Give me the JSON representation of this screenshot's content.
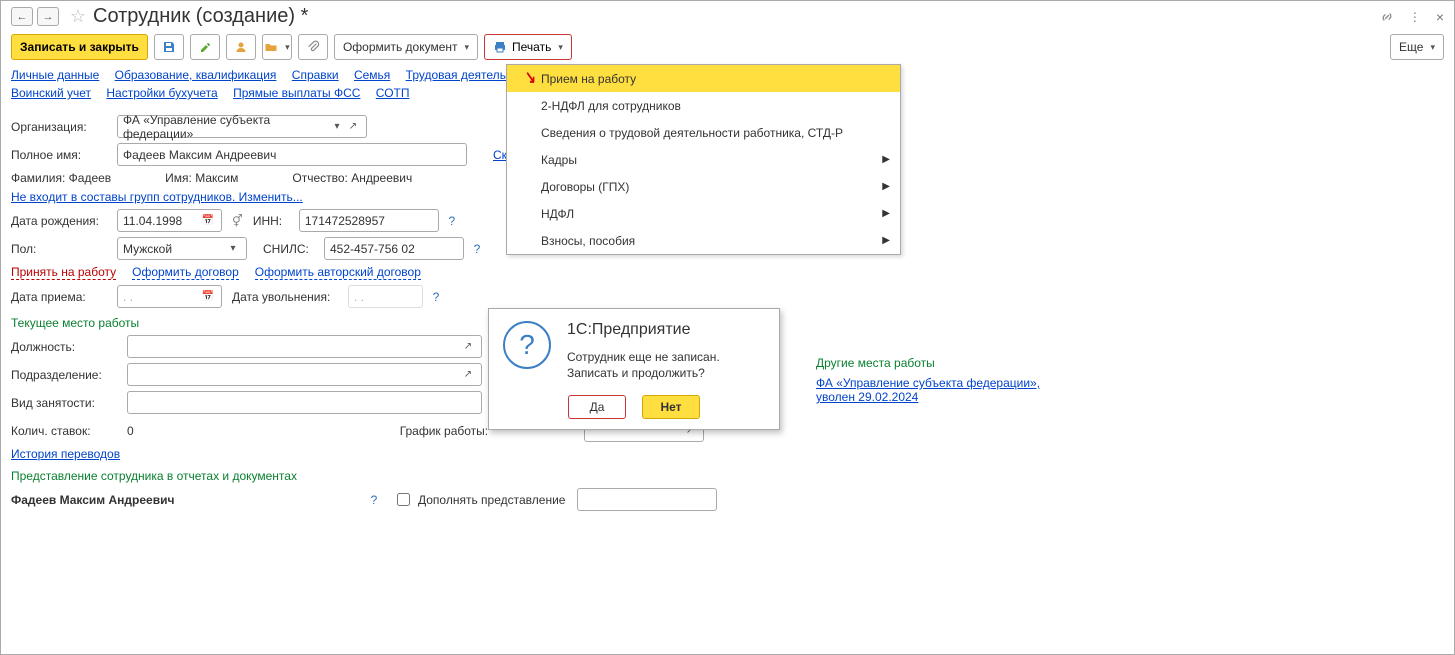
{
  "header": {
    "title": "Сотрудник (создание) *"
  },
  "toolbar": {
    "save_close": "Записать и закрыть",
    "make_doc": "Оформить документ",
    "print": "Печать",
    "more": "Еще"
  },
  "tabs1": {
    "personal": "Личные данные",
    "education": "Образование, квалификация",
    "refs": "Справки",
    "family": "Семья",
    "work_hist": "Трудовая деятельн",
    "declension": "Скл"
  },
  "tabs2": {
    "military": "Воинский учет",
    "buh": "Настройки бухучета",
    "fss": "Прямые выплаты ФСС",
    "sotp": "СОТП"
  },
  "form": {
    "org_label": "Организация:",
    "org_value": "ФА «Управление субъекта федерации»",
    "fullname_label": "Полное имя:",
    "fullname_value": "Фадеев Максим Андреевич",
    "surname_label": "Фамилия:",
    "surname_value": "Фадеев",
    "name_label": "Имя:",
    "name_value": "Максим",
    "patronymic_label": "Отчество:",
    "patronymic_value": "Андреевич",
    "groups_link": "Не входит в составы групп сотрудников. Изменить...",
    "birth_label": "Дата рождения:",
    "birth_value": "11.04.1998",
    "inn_label": "ИНН:",
    "inn_value": "171472528957",
    "sex_label": "Пол:",
    "sex_value": "Мужской",
    "snils_label": "СНИЛС:",
    "snils_value": "452-457-756 02",
    "hire": "Принять на работу",
    "contract": "Оформить договор",
    "author_contract": "Оформить авторский договор",
    "hire_date_label": "Дата приема:",
    "hire_date_value": "  .  .",
    "fire_date_label": "Дата увольнения:",
    "fire_date_value": "  .  .",
    "current_place": "Текущее место работы",
    "position_label": "Должность:",
    "department_label": "Подразделение:",
    "emptype_label": "Вид занятости:",
    "rates_label": "Колич. ставок:",
    "rates_value": "0",
    "schedule_label": "График работы:",
    "transfer_history": "История переводов",
    "repr_title": "Представление сотрудника в отчетах и документах",
    "repr_value": "Фадеев Максим Андреевич",
    "repr_checkbox": "Дополнять представление"
  },
  "other": {
    "title": "Другие места работы",
    "link1": "ФА «Управление субъекта федерации», уволен 29.02.2024"
  },
  "print_menu": {
    "i1": "Прием на работу",
    "i2": "2-НДФЛ для сотрудников",
    "i3": "Сведения о трудовой деятельности работника, СТД-Р",
    "i4": "Кадры",
    "i5": "Договоры (ГПХ)",
    "i6": "НДФЛ",
    "i7": "Взносы, пособия"
  },
  "modal": {
    "title": "1С:Предприятие",
    "line1": "Сотрудник еще не записан.",
    "line2": "Записать и продолжить?",
    "yes": "Да",
    "no": "Нет"
  }
}
